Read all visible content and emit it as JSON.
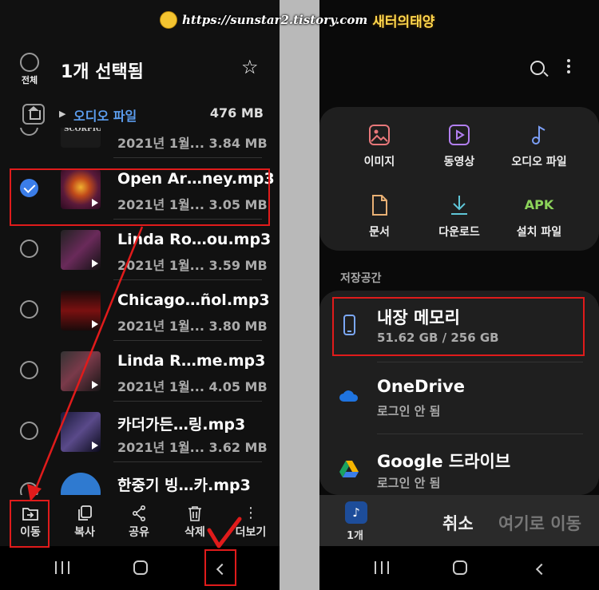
{
  "watermark": {
    "url": "https://sunstar2.tistory.com",
    "name": "새터의태양"
  },
  "left": {
    "select_all_label": "전체",
    "title": "1개 선택됨",
    "path": {
      "name": "오디오 파일",
      "size": "476 MB"
    },
    "files": [
      {
        "name": "",
        "date": "2021년 1월...",
        "size": "3.84 MB",
        "selected": false
      },
      {
        "name": "Open Ar…ney.mp3",
        "date": "2021년 1월...",
        "size": "3.05 MB",
        "selected": true
      },
      {
        "name": "Linda Ro…ou.mp3",
        "date": "2021년 1월...",
        "size": "3.59 MB",
        "selected": false
      },
      {
        "name": "Chicago…ñol.mp3",
        "date": "2021년 1월...",
        "size": "3.80 MB",
        "selected": false
      },
      {
        "name": "Linda R…me.mp3",
        "date": "2021년 1월...",
        "size": "4.05 MB",
        "selected": false
      },
      {
        "name": "카더가든…링.mp3",
        "date": "2021년 1월...",
        "size": "3.62 MB",
        "selected": false
      },
      {
        "name": "한중기 빙…카.mp3",
        "date": "",
        "size": "",
        "selected": false
      }
    ],
    "actions": {
      "move": "이동",
      "copy": "복사",
      "share": "공유",
      "delete": "삭제",
      "more": "더보기"
    }
  },
  "right": {
    "categories": {
      "images": "이미지",
      "videos": "동영상",
      "audio": "오디오 파일",
      "documents": "문서",
      "downloads": "다운로드",
      "apk_icon": "APK",
      "installers": "설치 파일"
    },
    "storage_label": "저장공간",
    "storage": {
      "internal": {
        "title": "내장 메모리",
        "sub": "51.62 GB / 256 GB"
      },
      "onedrive": {
        "title": "OneDrive",
        "sub": "로그인 안 됨"
      },
      "gdrive": {
        "title": "Google 드라이브",
        "sub": "로그인 안 됨"
      }
    },
    "move_bar": {
      "count": "1개",
      "cancel": "취소",
      "move_here": "여기로 이동"
    }
  }
}
